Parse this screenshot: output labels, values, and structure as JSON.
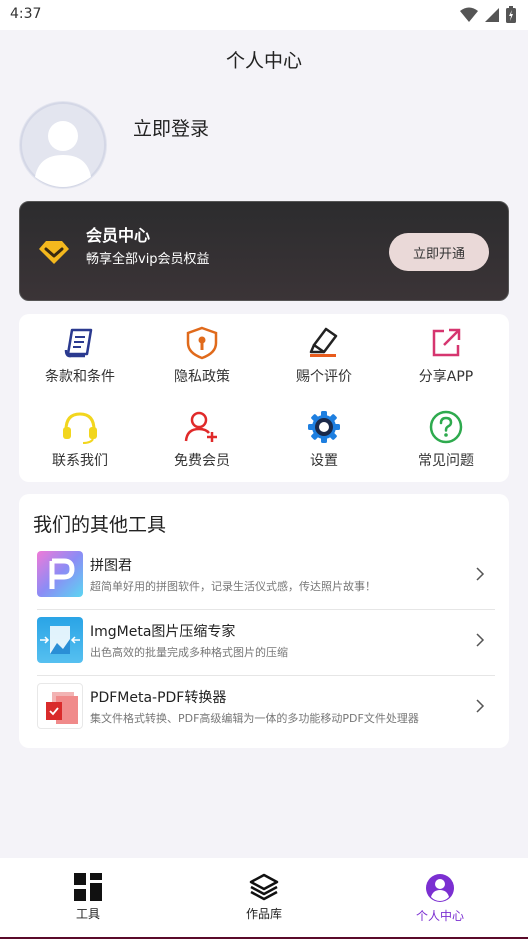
{
  "status_bar": {
    "time": "4:37"
  },
  "header": {
    "title": "个人中心"
  },
  "profile": {
    "login_label": "立即登录"
  },
  "vip": {
    "title": "会员中心",
    "subtitle": "畅享全部vip会员权益",
    "button_label": "立即开通",
    "icon": "diamond-icon"
  },
  "menu": {
    "items": [
      {
        "label": "条款和条件",
        "icon": "document-icon"
      },
      {
        "label": "隐私政策",
        "icon": "shield-lock-icon"
      },
      {
        "label": "赐个评价",
        "icon": "eraser-pen-icon"
      },
      {
        "label": "分享APP",
        "icon": "external-link-icon"
      },
      {
        "label": "联系我们",
        "icon": "headset-icon"
      },
      {
        "label": "免费会员",
        "icon": "add-user-icon"
      },
      {
        "label": "设置",
        "icon": "gear-icon"
      },
      {
        "label": "常见问题",
        "icon": "question-icon"
      }
    ]
  },
  "tools": {
    "title": "我们的其他工具",
    "items": [
      {
        "name": "拼图君",
        "desc": "超简单好用的拼图软件，记录生活仪式感，传达照片故事！"
      },
      {
        "name": "ImgMeta图片压缩专家",
        "desc": "出色高效的批量完成多种格式图片的压缩"
      },
      {
        "name": "PDFMeta-PDF转换器",
        "desc": "集文件格式转换、PDF高级编辑为一体的多功能移动PDF文件处理器"
      }
    ]
  },
  "tab_bar": {
    "tabs": [
      {
        "label": "工具",
        "icon": "grid-icon"
      },
      {
        "label": "作品库",
        "icon": "layers-icon"
      },
      {
        "label": "个人中心",
        "icon": "user-circle-icon",
        "active": true
      }
    ]
  },
  "colors": {
    "accent": "#7b2fd1",
    "vip_gold": "#f4b81e"
  }
}
